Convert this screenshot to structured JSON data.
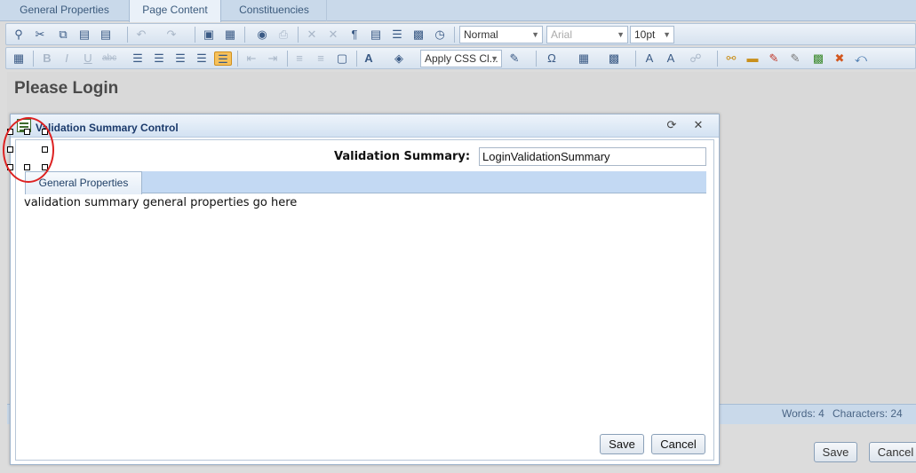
{
  "top_tabs": [
    "General Properties",
    "Page Content",
    "Constituencies"
  ],
  "active_tab": "Page Content",
  "toolbar": {
    "format_select": "Normal",
    "font_select": "Arial",
    "size_select": "10pt",
    "css_class_select": "Apply CSS Cl..."
  },
  "icons": {
    "tb1": [
      "find-icon",
      "cut-icon",
      "copy-icon",
      "paste-icon",
      "paste-options-icon",
      "undo-icon",
      "redo-icon",
      "image-manager-icon",
      "document-manager-icon",
      "spellcheck-icon",
      "print-icon",
      "strip-icon",
      "remove-format-icon",
      "paragraph-icon",
      "page-icon",
      "justify-icon",
      "template-icon",
      "clock-icon"
    ],
    "tb2": [
      "select-all-icon",
      "bold-icon",
      "italic-icon",
      "underline-icon",
      "strikethrough-icon",
      "align-left-icon",
      "align-center-icon",
      "align-right-icon",
      "align-justify-icon",
      "align-none-icon",
      "outdent-icon",
      "indent-icon",
      "numbered-list-icon",
      "bulleted-list-icon",
      "insert-box-icon",
      "font-color-icon",
      "highlight-color-icon",
      "format-brush-icon",
      "symbol-icon",
      "table-icon",
      "snippet-icon",
      "superscript-icon",
      "spell-icon",
      "hyperlink-icon",
      "link-icon",
      "form-icon",
      "form-element-icon",
      "control-icon",
      "delete-control-icon",
      "redirect-icon"
    ]
  },
  "editor": {
    "heading": "Please Login"
  },
  "status": {
    "words": "Words: 4",
    "characters": "Characters: 24"
  },
  "outer_buttons": {
    "save": "Save",
    "cancel": "Cancel"
  },
  "dialog": {
    "title": "Validation Summary Control",
    "field_label": "Validation Summary:",
    "field_value": "LoginValidationSummary",
    "inner_tab": "General Properties",
    "body_text": "validation summary general properties go here",
    "save": "Save",
    "cancel": "Cancel"
  },
  "colors": {
    "accent": "#c9d9ea",
    "dialog_title": "#1b3a6b",
    "annotation_ring": "#dd2222"
  }
}
